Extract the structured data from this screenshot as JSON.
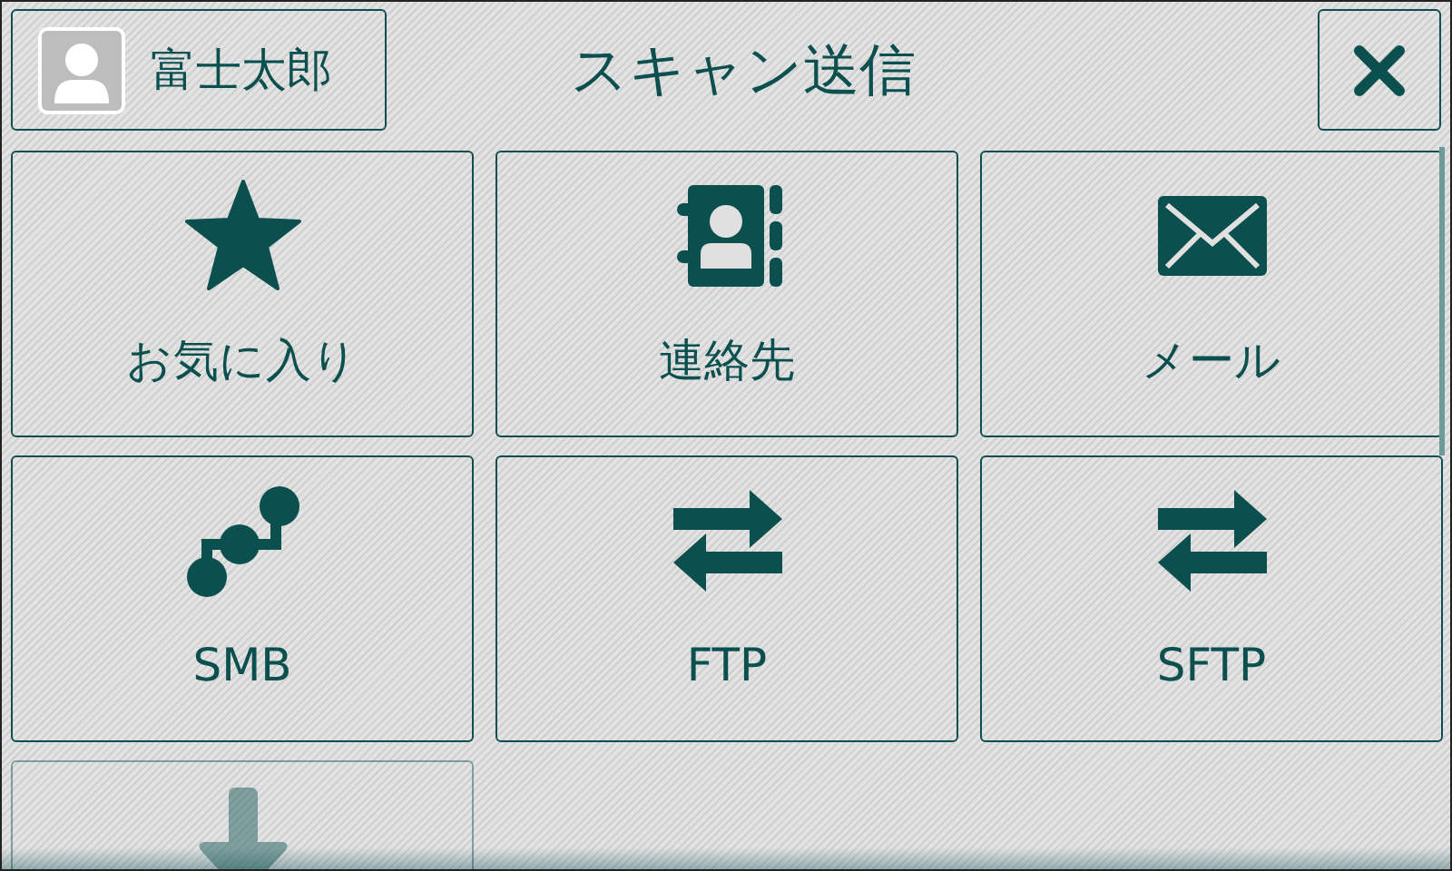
{
  "header": {
    "user": {
      "name": "富士太郎"
    },
    "title": "スキャン送信"
  },
  "tiles": [
    {
      "kind": "favorites",
      "label": "お気に入り",
      "dimmed": false
    },
    {
      "kind": "contacts",
      "label": "連絡先",
      "dimmed": false
    },
    {
      "kind": "mail",
      "label": "メール",
      "dimmed": false
    },
    {
      "kind": "smb",
      "label": "SMB",
      "dimmed": false
    },
    {
      "kind": "ftp",
      "label": "FTP",
      "dimmed": false
    },
    {
      "kind": "ftp",
      "label": "SFTP",
      "dimmed": false
    },
    {
      "kind": "download",
      "dimmed": true
    }
  ]
}
